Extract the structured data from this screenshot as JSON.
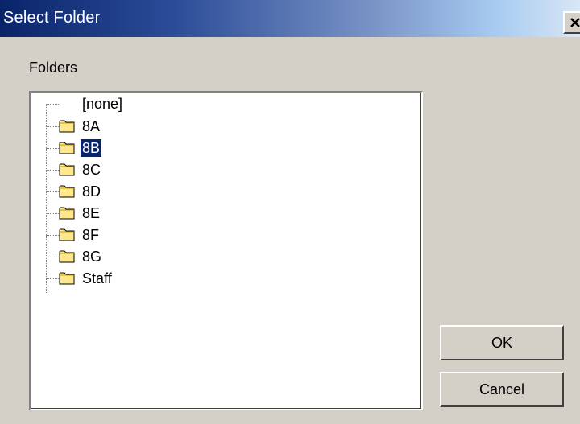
{
  "window": {
    "title": "Select Folder",
    "close_label": "✕"
  },
  "folders_label": "Folders",
  "tree": {
    "items": [
      {
        "label": "[none]",
        "icon": "none",
        "selected": false
      },
      {
        "label": "8A",
        "icon": "folder-icon",
        "selected": false
      },
      {
        "label": "8B",
        "icon": "folder-icon",
        "selected": true
      },
      {
        "label": "8C",
        "icon": "folder-icon",
        "selected": false
      },
      {
        "label": "8D",
        "icon": "folder-icon",
        "selected": false
      },
      {
        "label": "8E",
        "icon": "folder-icon",
        "selected": false
      },
      {
        "label": "8F",
        "icon": "folder-icon",
        "selected": false
      },
      {
        "label": "8G",
        "icon": "folder-icon",
        "selected": false
      },
      {
        "label": "Staff",
        "icon": "folder-icon",
        "selected": false
      }
    ]
  },
  "buttons": {
    "ok_label": "OK",
    "cancel_label": "Cancel"
  },
  "colors": {
    "title_bar_start": "#0a246a",
    "selection": "#0a246a",
    "folder_fill": "#ffe88c",
    "window_bg": "#d4d0c8"
  }
}
